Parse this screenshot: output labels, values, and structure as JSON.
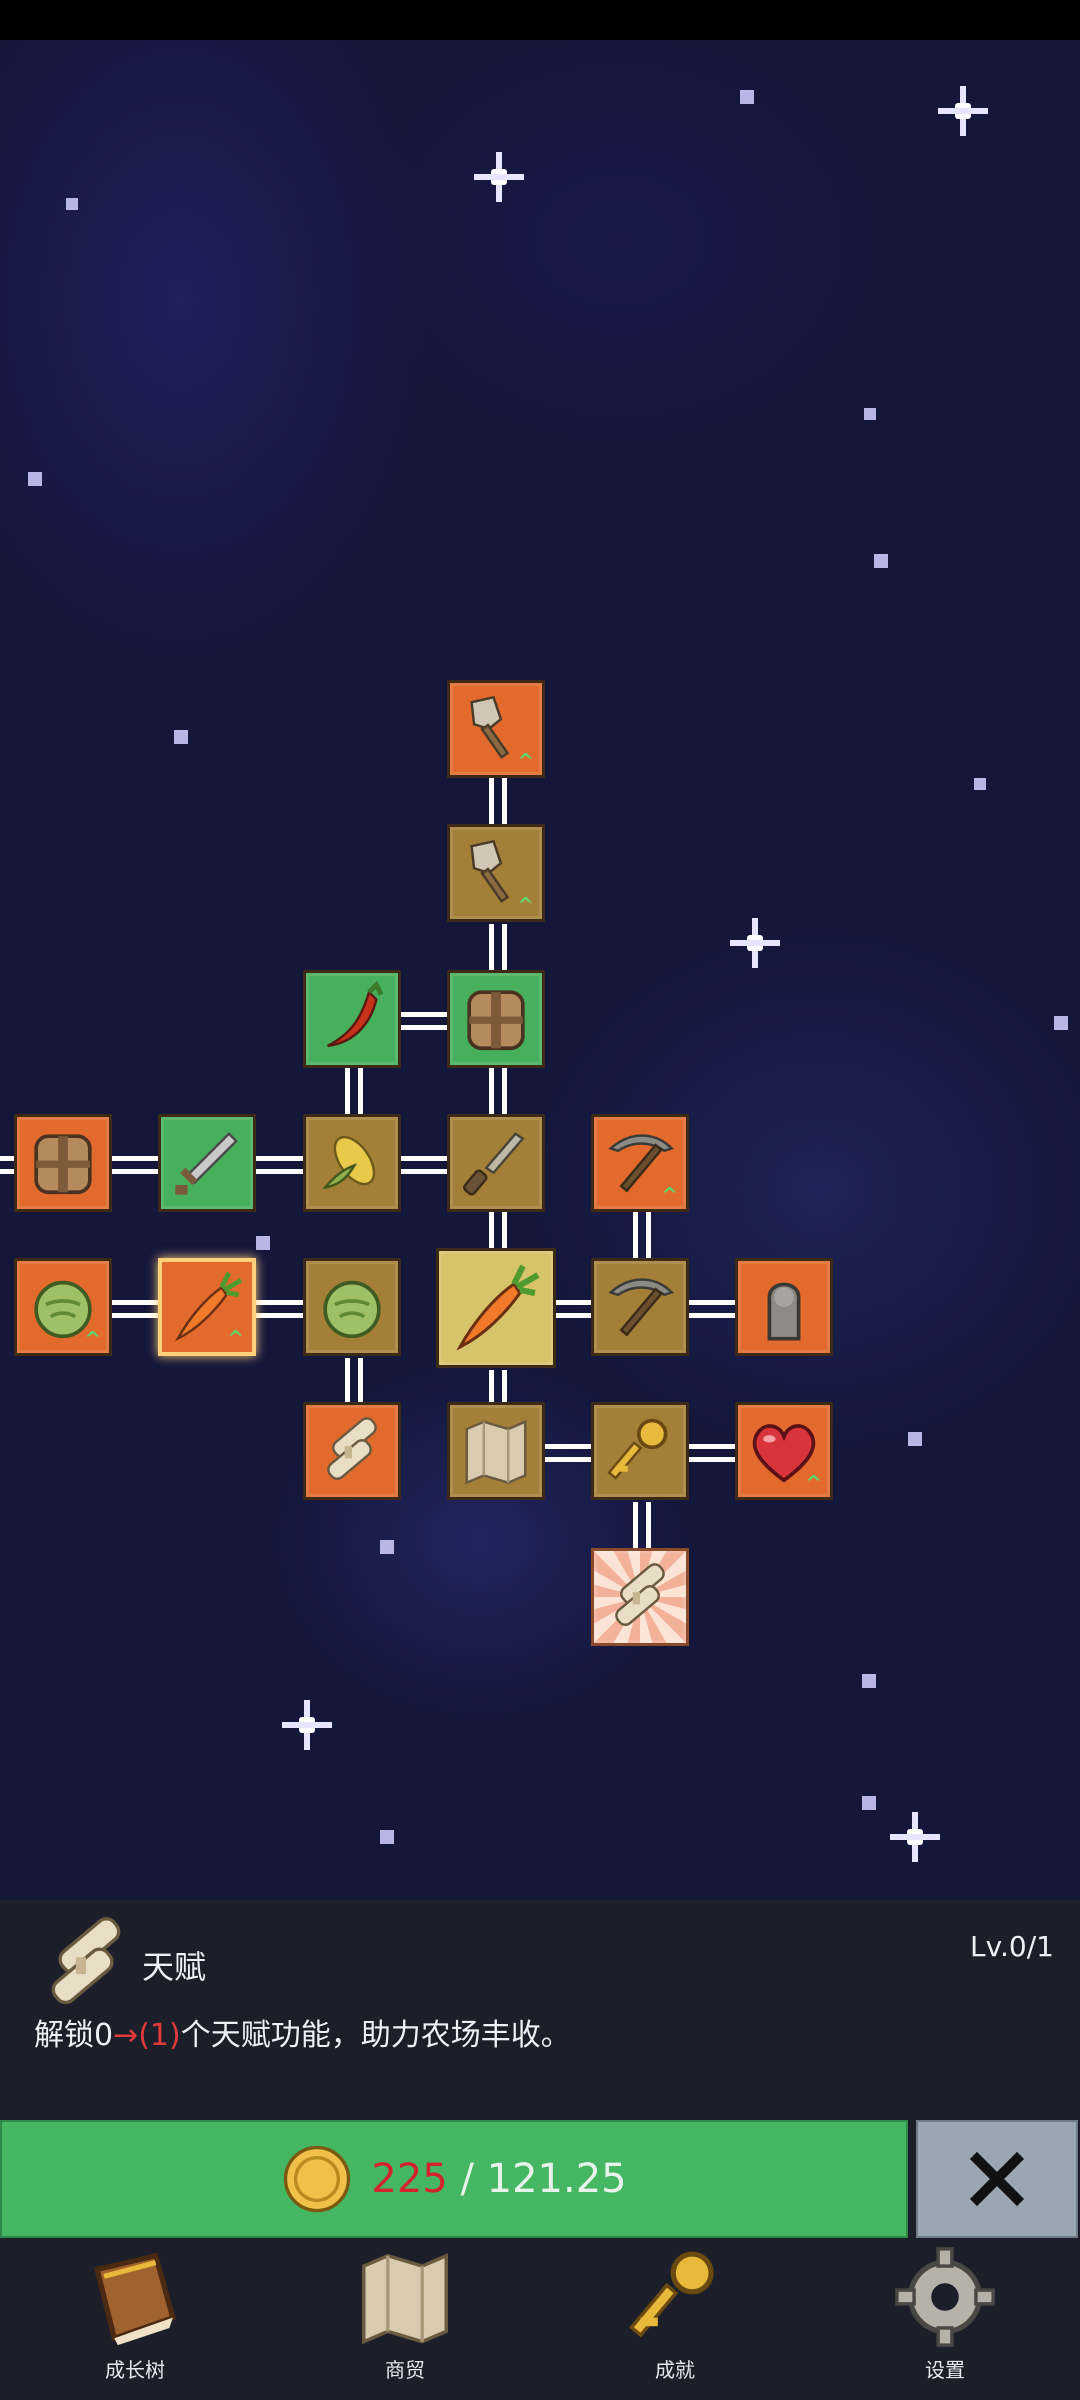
{
  "tree": {
    "nodes": [
      {
        "icon": "shovel-icon",
        "color": "orange",
        "upgrade": true
      },
      {
        "icon": "shovel-icon",
        "color": "olive",
        "upgrade": true
      },
      {
        "icon": "chili-pepper-icon",
        "color": "green",
        "upgrade": false
      },
      {
        "icon": "backpack-icon",
        "color": "green",
        "upgrade": false
      },
      {
        "icon": "backpack-icon",
        "color": "orange",
        "upgrade": false
      },
      {
        "icon": "sword-icon",
        "color": "green",
        "upgrade": false
      },
      {
        "icon": "corn-icon",
        "color": "olive",
        "upgrade": false
      },
      {
        "icon": "knife-icon",
        "color": "olive",
        "upgrade": false
      },
      {
        "icon": "pickaxe-icon",
        "color": "orange",
        "upgrade": true
      },
      {
        "icon": "cabbage-icon",
        "color": "orange",
        "upgrade": true
      },
      {
        "icon": "carrot-icon",
        "color": "orange",
        "upgrade": true,
        "selected": true
      },
      {
        "icon": "cabbage-icon",
        "color": "olive",
        "upgrade": false
      },
      {
        "icon": "carrot-icon",
        "color": "cream",
        "upgrade": false
      },
      {
        "icon": "pickaxe-icon",
        "color": "olive",
        "upgrade": false
      },
      {
        "icon": "statue-icon",
        "color": "orange",
        "upgrade": false
      },
      {
        "icon": "scroll-icon",
        "color": "orange",
        "upgrade": false
      },
      {
        "icon": "map-icon",
        "color": "olive",
        "upgrade": false
      },
      {
        "icon": "key-icon",
        "color": "olive",
        "upgrade": false
      },
      {
        "icon": "heart-icon",
        "color": "orange",
        "upgrade": true
      },
      {
        "icon": "scroll-icon",
        "color": "burst",
        "upgrade": false
      }
    ]
  },
  "info": {
    "icon": "scroll-icon",
    "title": "天赋",
    "level": "Lv.0/1",
    "desc_prefix": "解锁0",
    "desc_change": "→(1)",
    "desc_suffix": "个天赋功能，助力农场丰收。"
  },
  "actions": {
    "coin_icon": "coin-icon",
    "price_current": "225",
    "price_separator": " / ",
    "price_cost": "121.25",
    "close_icon": "close-icon"
  },
  "nav": {
    "items": [
      {
        "label": "成长树",
        "icon": "book-icon"
      },
      {
        "label": "商贸",
        "icon": "map-icon"
      },
      {
        "label": "成就",
        "icon": "key-icon"
      },
      {
        "label": "设置",
        "icon": "gear-icon"
      }
    ]
  },
  "colors": {
    "orange": "#e26a2c",
    "olive": "#a47f37",
    "green": "#46b05c",
    "cream": "#d7c36a",
    "button_green": "#45b662",
    "price_red": "#d3232b",
    "panel": "#1c1f2a"
  }
}
